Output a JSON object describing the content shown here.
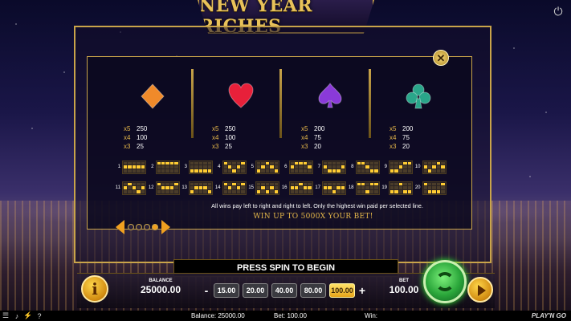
{
  "game": {
    "title": "NEW YEAR RICHES"
  },
  "paytable": {
    "symbols": [
      {
        "name": "diamond",
        "color": "#f08a2a",
        "pays": [
          {
            "mult": "x5",
            "value": "250"
          },
          {
            "mult": "x4",
            "value": "100"
          },
          {
            "mult": "x3",
            "value": "25"
          }
        ]
      },
      {
        "name": "heart",
        "color": "#e8203a",
        "pays": [
          {
            "mult": "x5",
            "value": "250"
          },
          {
            "mult": "x4",
            "value": "100"
          },
          {
            "mult": "x3",
            "value": "25"
          }
        ]
      },
      {
        "name": "spade",
        "color": "#8a3ad8",
        "pays": [
          {
            "mult": "x5",
            "value": "200"
          },
          {
            "mult": "x4",
            "value": "75"
          },
          {
            "mult": "x3",
            "value": "20"
          }
        ]
      },
      {
        "name": "club",
        "color": "#2aa68a",
        "pays": [
          {
            "mult": "x5",
            "value": "200"
          },
          {
            "mult": "x4",
            "value": "75"
          },
          {
            "mult": "x3",
            "value": "20"
          }
        ]
      }
    ],
    "paylines": [
      {
        "num": "1",
        "rows": [
          1,
          1,
          1,
          1,
          1
        ]
      },
      {
        "num": "2",
        "rows": [
          0,
          0,
          0,
          0,
          0
        ]
      },
      {
        "num": "3",
        "rows": [
          2,
          2,
          2,
          2,
          2
        ]
      },
      {
        "num": "4",
        "rows": [
          0,
          1,
          2,
          1,
          0
        ]
      },
      {
        "num": "5",
        "rows": [
          2,
          1,
          0,
          1,
          2
        ]
      },
      {
        "num": "6",
        "rows": [
          1,
          0,
          0,
          0,
          1
        ]
      },
      {
        "num": "7",
        "rows": [
          1,
          2,
          2,
          2,
          1
        ]
      },
      {
        "num": "8",
        "rows": [
          0,
          0,
          1,
          2,
          2
        ]
      },
      {
        "num": "9",
        "rows": [
          2,
          2,
          1,
          0,
          0
        ]
      },
      {
        "num": "10",
        "rows": [
          1,
          2,
          1,
          0,
          1
        ]
      },
      {
        "num": "11",
        "rows": [
          1,
          0,
          1,
          2,
          1
        ]
      },
      {
        "num": "12",
        "rows": [
          0,
          1,
          1,
          1,
          0
        ]
      },
      {
        "num": "13",
        "rows": [
          2,
          1,
          1,
          1,
          2
        ]
      },
      {
        "num": "14",
        "rows": [
          0,
          1,
          0,
          1,
          0
        ]
      },
      {
        "num": "15",
        "rows": [
          2,
          1,
          2,
          1,
          2
        ]
      },
      {
        "num": "16",
        "rows": [
          1,
          1,
          0,
          1,
          1
        ]
      },
      {
        "num": "17",
        "rows": [
          1,
          1,
          2,
          1,
          1
        ]
      },
      {
        "num": "18",
        "rows": [
          0,
          0,
          2,
          0,
          0
        ]
      },
      {
        "num": "19",
        "rows": [
          2,
          2,
          0,
          2,
          2
        ]
      },
      {
        "num": "20",
        "rows": [
          0,
          2,
          2,
          2,
          0
        ]
      }
    ],
    "rules_text": "All wins pay left to right and right to left. Only the highest win paid per selected line.",
    "max_win_text": "WIN UP TO 5000X YOUR BET!",
    "page_count": 4,
    "current_page": 4
  },
  "message_bar": {
    "text": "PRESS SPIN TO BEGIN"
  },
  "controls": {
    "info_label": "i",
    "balance_label": "BALANCE",
    "balance_value": "25000.00",
    "minus_label": "-",
    "plus_label": "+",
    "bet_options": [
      "15.00",
      "20.00",
      "40.00",
      "80.00",
      "100.00"
    ],
    "selected_bet": "100.00",
    "bet_label": "BET",
    "bet_value": "100.00",
    "close_label": "✕",
    "power_label": "⏻"
  },
  "status_bar": {
    "balance_text": "Balance: 25000.00",
    "bet_text": "Bet: 100.00",
    "win_text": "Win:",
    "brand": "PLAY'N GO"
  }
}
